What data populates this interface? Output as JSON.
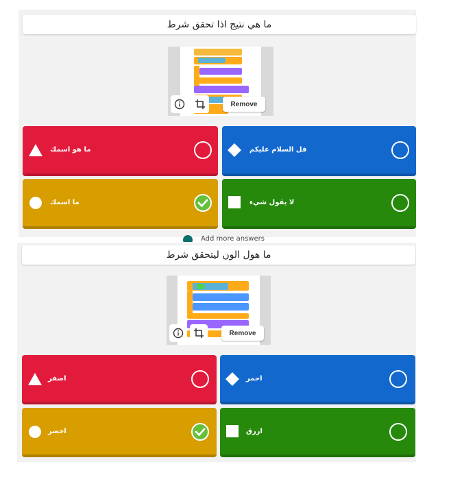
{
  "questions": [
    {
      "title": "ما هي نتيج  اذا تحقق شرط",
      "remove_label": "Remove",
      "thumbnail_labels": [
        "مقلمي 1",
        "اذا",
        "قل",
        "قل"
      ],
      "answers": [
        {
          "text": "ما  هو اسمك",
          "color": "#e21b3c",
          "shape": "triangle",
          "correct": false
        },
        {
          "text": "قل السلام عليكم",
          "color": "#1368ce",
          "shape": "diamond",
          "correct": false
        },
        {
          "text": "ما اسمك",
          "color": "#d89e00",
          "shape": "circle",
          "correct": true
        },
        {
          "text": "لا يقول شيء",
          "color": "#26890c",
          "shape": "square",
          "correct": false
        }
      ]
    },
    {
      "title": "ما هول الون ليتحقق شرط",
      "remove_label": "Remove",
      "thumbnail_labels": [
        "اللون",
        "حرك",
        "دور",
        "تغير"
      ],
      "answers": [
        {
          "text": "اصفر",
          "color": "#e21b3c",
          "shape": "triangle",
          "correct": false
        },
        {
          "text": "احمر",
          "color": "#1368ce",
          "shape": "diamond",
          "correct": false
        },
        {
          "text": "اخضر",
          "color": "#d89e00",
          "shape": "circle",
          "correct": true
        },
        {
          "text": "ازرق",
          "color": "#26890c",
          "shape": "square",
          "correct": false
        }
      ]
    }
  ],
  "add_more_label": "Add more answers",
  "icons": {
    "info": "info-icon",
    "crop": "crop-icon",
    "check": "check-icon",
    "triangle": "triangle-icon",
    "diamond": "diamond-icon",
    "circle": "circle-icon",
    "square": "square-icon"
  }
}
